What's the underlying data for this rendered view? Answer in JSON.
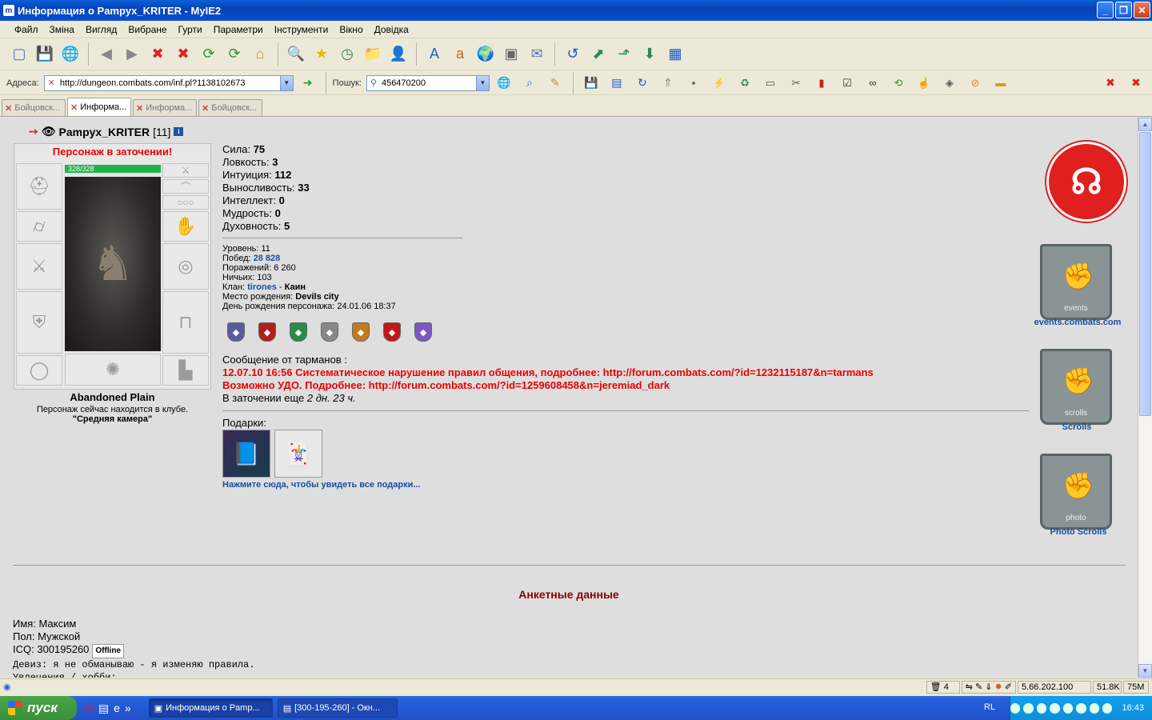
{
  "window": {
    "title": "Информация о Pampyx_KRITER - MyIE2"
  },
  "menu": [
    "Файл",
    "Зміна",
    "Вигляд",
    "Вибране",
    "Гурти",
    "Параметри",
    "Інструменти",
    "Вікно",
    "Довідка"
  ],
  "address": {
    "label": "Адреса:",
    "url": "http://dungeon.combats.com/inf.pl?1138102673"
  },
  "search": {
    "label": "Пошук:",
    "value": "456470200"
  },
  "tabs": [
    {
      "label": "Бойцовск..."
    },
    {
      "label": "Информа..."
    },
    {
      "label": "Информа..."
    },
    {
      "label": "Бойцовск..."
    }
  ],
  "character": {
    "name": "Pampyx_KRITER",
    "level": "[11]",
    "prison_notice": "Персонаж в заточении!",
    "hp": "328/328",
    "location": "Abandoned Plain",
    "location_note": "Персонаж сейчас находится в клубе.",
    "room": "\"Средняя камера\""
  },
  "stats": [
    {
      "label": "Сила:",
      "value": "75"
    },
    {
      "label": "Ловкость:",
      "value": "3"
    },
    {
      "label": "Интуиция:",
      "value": "112"
    },
    {
      "label": "Выносливость:",
      "value": "33"
    },
    {
      "label": "Интеллект:",
      "value": "0"
    },
    {
      "label": "Мудрость:",
      "value": "0"
    },
    {
      "label": "Духовность:",
      "value": "5"
    }
  ],
  "details": {
    "level": "Уровень: 11",
    "wins_label": "Побед:",
    "wins": "28 828",
    "losses": "Поражений: 6 260",
    "draws": "Ничьих: 103",
    "clan_label": "Клан:",
    "clan": "tirones",
    "clan_sep": "-",
    "clan_rank": "Каин",
    "birthplace_label": "Место рождения:",
    "birthplace": "Devils city",
    "birthday": "День рождения персонажа: 24.01.06 18:37"
  },
  "medal_colors": [
    "#5a5aa0",
    "#b02020",
    "#2a8a4a",
    "#888888",
    "#c07a20",
    "#c01818",
    "#7a5ac0"
  ],
  "messages": {
    "header": "Сообщение от тарманов :",
    "line1": "12.07.10 16:56 Систематическое нарушение правил общения, подробнее: http://forum.combats.com/?id=1232115187&n=tarmans",
    "line2": "Возможно УДО. Подробнее: http://forum.combats.com/?id=1259608458&n=jeremiad_dark",
    "prison_prefix": "В заточении еще",
    "prison_time": "2 дн. 23 ч."
  },
  "gifts": {
    "label": "Подарки:",
    "link": "Нажмите сюда, чтобы увидеть все подарки..."
  },
  "side_links": [
    {
      "label": "events.combats.com",
      "caption": "events"
    },
    {
      "label": "Scrolls",
      "caption": "scrolls"
    },
    {
      "label": "Photo Scrolls",
      "caption": "photo"
    }
  ],
  "profile": {
    "section_title": "Анкетные данные",
    "name": "Имя: Максим",
    "gender": "Пол: Мужской",
    "icq": "ICQ: 300195260",
    "icq_status": "Offline",
    "motto": "Девиз: я не обманываю - я изменяю правила.",
    "hobby": "Увлечения / хобби:"
  },
  "statusbar": {
    "tabs_count": "4",
    "ip": "5.66.202.100",
    "traffic": "51.8K",
    "mem": "75M"
  },
  "taskbar": {
    "start": "пуск",
    "tasks": [
      "Информация о Pamp...",
      "[300-195-260] - Окн..."
    ],
    "lang": "RL",
    "clock": "16:43"
  }
}
